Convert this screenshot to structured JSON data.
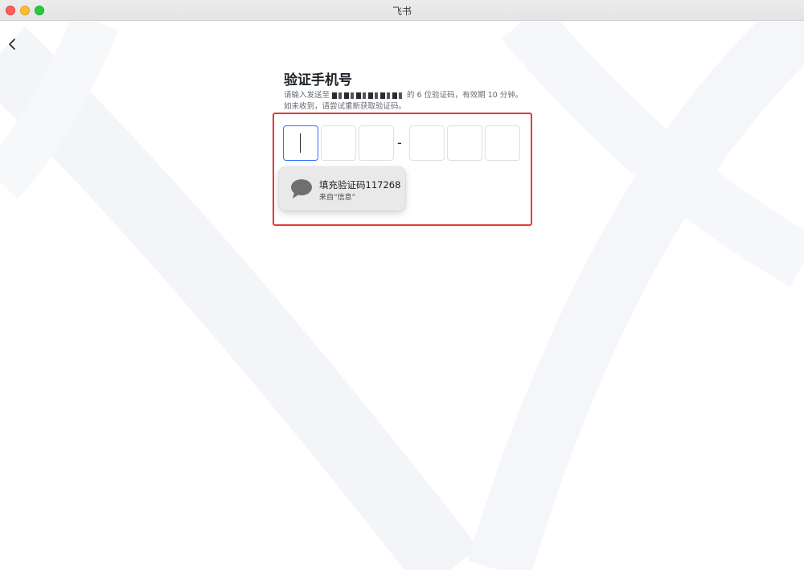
{
  "window": {
    "title": "飞书"
  },
  "page": {
    "title": "验证手机号",
    "description_prefix": "请输入发送至",
    "description_suffix": "的 6 位验证码，有效期 10 分钟。如未收到，请尝试重新获取验证码。"
  },
  "code": {
    "separator": "-",
    "digits": [
      "",
      "",
      "",
      "",
      "",
      ""
    ]
  },
  "autofill": {
    "title": "填充验证码117268",
    "source": "来自“信息”"
  },
  "icons": {
    "back": "chevron-left-icon",
    "message": "message-bubble-icon"
  },
  "colors": {
    "highlight": "#e53935",
    "active_border": "#3370ff"
  }
}
